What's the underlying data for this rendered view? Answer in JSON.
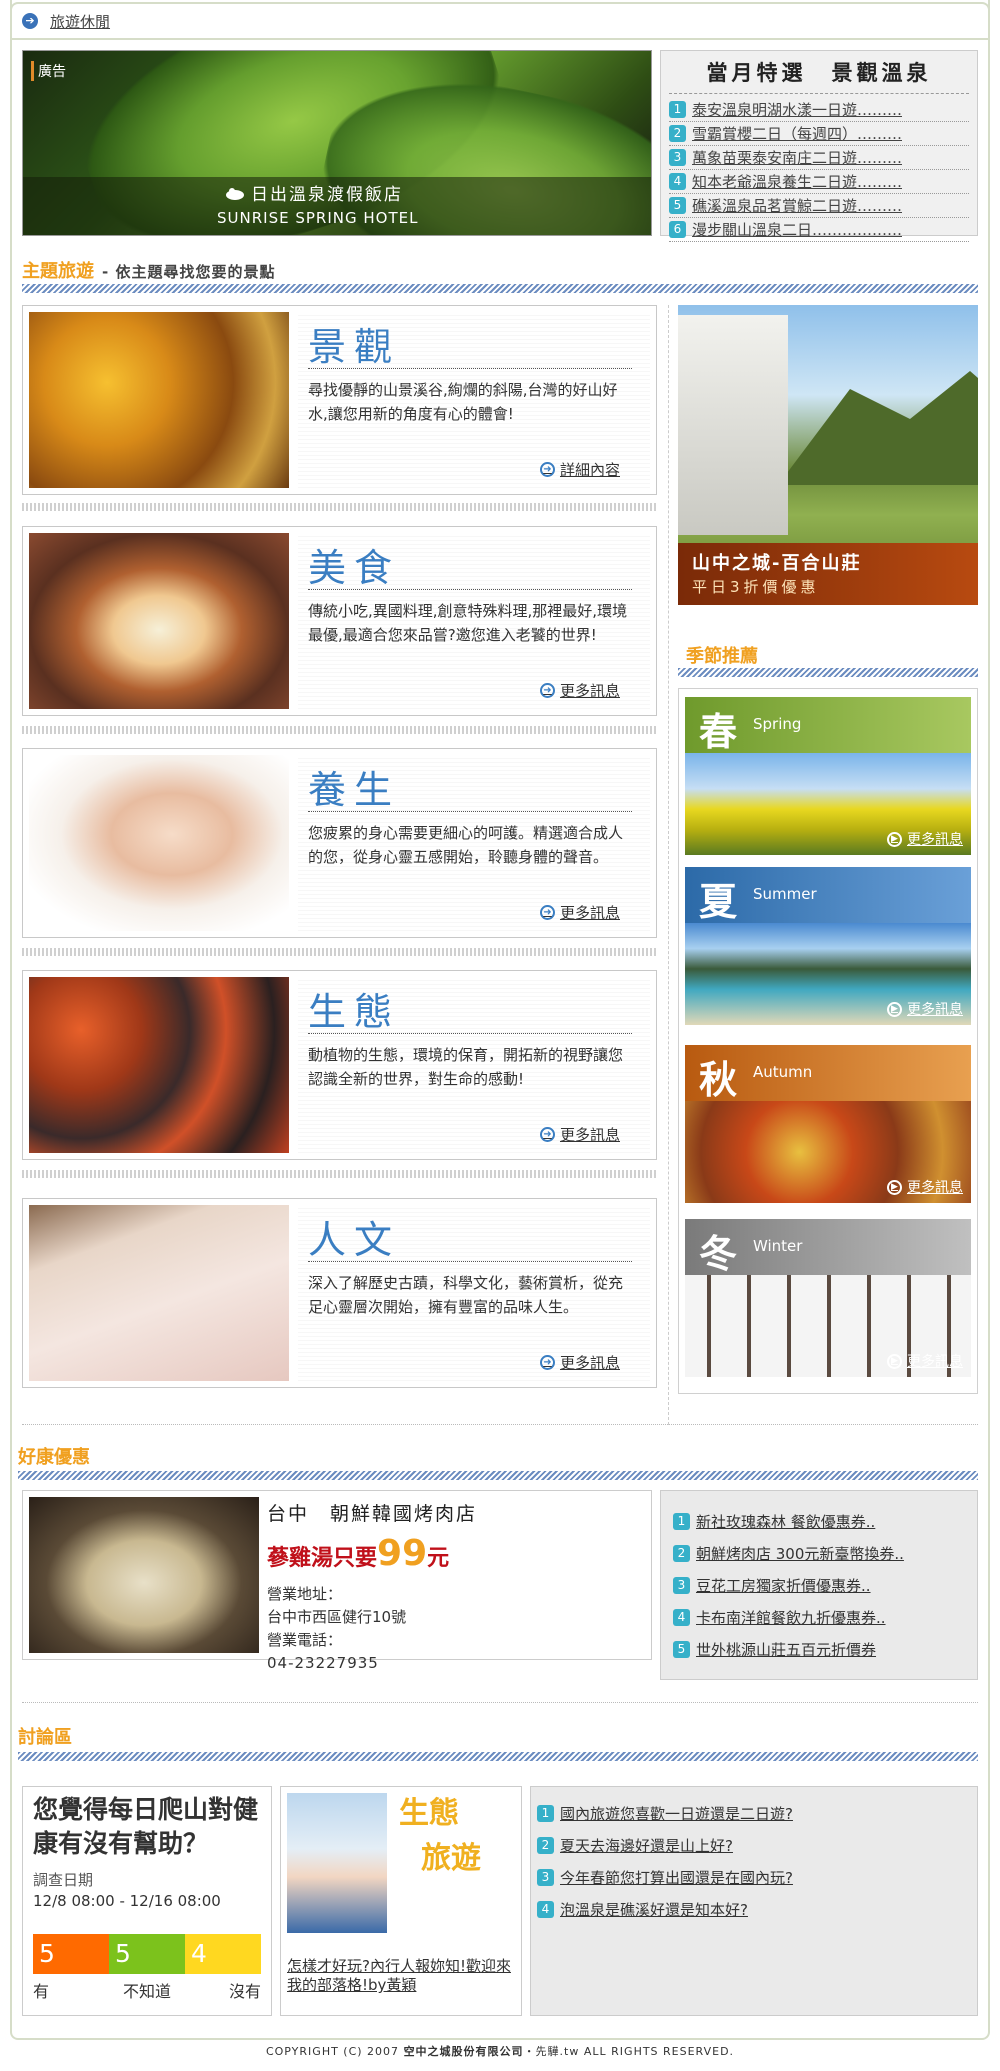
{
  "breadcrumb": {
    "label": "旅遊休閒"
  },
  "banner": {
    "ad_label": "廣告",
    "hotel_cn": "日出溫泉渡假飯店",
    "hotel_en": "SUNRISE SPRING HOTEL"
  },
  "special": {
    "title": "當月特選　景觀溫泉",
    "items": [
      {
        "num": "1",
        "text": "泰安溫泉明湖水漾一日遊………"
      },
      {
        "num": "2",
        "text": "雪霸賞櫻二日（每週四）………"
      },
      {
        "num": "3",
        "text": "萬象苗栗泰安南庄二日遊………"
      },
      {
        "num": "4",
        "text": "知本老爺溫泉養生二日遊………"
      },
      {
        "num": "5",
        "text": "礁溪溫泉品茗賞鯨二日遊………"
      },
      {
        "num": "6",
        "text": "漫步關山溫泉二日………………"
      }
    ]
  },
  "theme": {
    "title": "主題旅遊",
    "subtitle": "- 依主題尋找您要的景點",
    "cards": [
      {
        "title": "景觀",
        "desc": "尋找優靜的山景溪谷,絢爛的斜陽,台灣的好山好水,讓您用新的角度有心的體會!",
        "more": "詳細內容"
      },
      {
        "title": "美食",
        "desc": "傳統小吃,異國料理,創意特殊料理,那裡最好,環境最優,最適合您來品嘗?邀您進入老饕的世界!",
        "more": "更多訊息"
      },
      {
        "title": "養生",
        "desc": "您疲累的身心需要更細心的呵護。精選適合成人的您，從身心靈五感開始，聆聽身體的聲音。",
        "more": "更多訊息"
      },
      {
        "title": "生態",
        "desc": "動植物的生態，環境的保育，開拓新的視野讓您認識全新的世界，對生命的感動!",
        "more": "更多訊息"
      },
      {
        "title": "人文",
        "desc": "深入了解歷史古蹟，科學文化，藝術賞析，從充足心靈層次開始，擁有豐富的品味人生。",
        "more": "更多訊息"
      }
    ]
  },
  "lodge": {
    "name": "山中之城-百合山莊",
    "deal": "平日3折價優惠"
  },
  "season": {
    "title": "季節推薦",
    "items": [
      {
        "cn": "春",
        "en": "Spring",
        "more": "更多訊息"
      },
      {
        "cn": "夏",
        "en": "Summer",
        "more": "更多訊息"
      },
      {
        "cn": "秋",
        "en": "Autumn",
        "more": "更多訊息"
      },
      {
        "cn": "冬",
        "en": "Winter",
        "more": "更多訊息"
      }
    ]
  },
  "promo": {
    "title": "好康優惠",
    "shop": "台中　朝鮮韓國烤肉店",
    "deal_prefix": "蔘雞湯只要",
    "deal_price": "99",
    "deal_unit": "元",
    "addr_label": "營業地址：",
    "addr": "台中市西區健行10號",
    "tel_label": "營業電話：",
    "tel": "04-23227935",
    "list": [
      {
        "num": "1",
        "text": "新社玫瑰森林 餐飲優惠券.."
      },
      {
        "num": "2",
        "text": "朝鮮烤肉店 300元新臺幣換券.."
      },
      {
        "num": "3",
        "text": "豆花工房獨家折價優惠券.."
      },
      {
        "num": "4",
        "text": "卡布南洋館餐飲九折優惠券.."
      },
      {
        "num": "5",
        "text": "世外桃源山莊五百元折價券"
      }
    ]
  },
  "forum": {
    "title": "討論區",
    "poll": {
      "question": "您覺得每日爬山對健康有沒有幫助？",
      "date_label": "調查日期",
      "date": "12/8 08:00 - 12/16 08:00",
      "values": [
        5,
        5,
        4
      ],
      "labels": [
        "有",
        "不知道",
        "沒有"
      ],
      "colors": [
        "#ff6a00",
        "#7cc21c",
        "#ffd820"
      ]
    },
    "eco": {
      "title1": "生態",
      "title2": "旅遊",
      "caption": "怎樣才好玩?內行人報妳知!歡迎來我的部落格!by黃穎"
    },
    "list": [
      {
        "num": "1",
        "text": "國內旅遊您喜歡一日遊還是二日遊?"
      },
      {
        "num": "2",
        "text": "夏天去海邊好還是山上好?"
      },
      {
        "num": "3",
        "text": "今年春節您打算出國還是在國內玩?"
      },
      {
        "num": "4",
        "text": "泡溫泉是礁溪好還是知本好?"
      }
    ]
  },
  "footer": {
    "prefix": "COPYRIGHT (C) 2007 ",
    "company": "空中之城股份有限公司",
    "sep": "・先驊.tw ",
    "suffix": "ALL RIGHTS RESERVED."
  }
}
